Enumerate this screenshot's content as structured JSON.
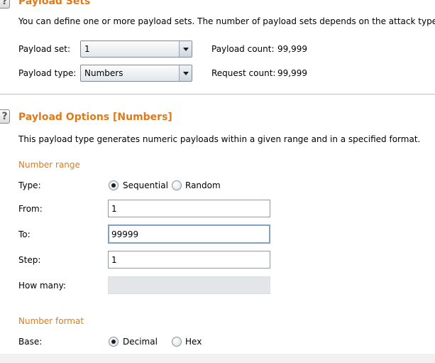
{
  "payload_sets": {
    "title": "Payload Sets",
    "description": "You can define one or more payload sets. The number of payload sets depends on the attack type def",
    "payload_set_label": "Payload set:",
    "payload_set_value": "1",
    "payload_type_label": "Payload type:",
    "payload_type_value": "Numbers",
    "payload_count_label": "Payload count:",
    "payload_count_value": "99,999",
    "request_count_label": "Request count:",
    "request_count_value": "99,999"
  },
  "payload_options": {
    "title": "Payload Options [Numbers]",
    "description": "This payload type generates numeric payloads within a given range and in a specified format.",
    "number_range": {
      "heading": "Number range",
      "type_label": "Type:",
      "type_options": [
        "Sequential",
        "Random"
      ],
      "type_selected": "Sequential",
      "from_label": "From:",
      "from_value": "1",
      "to_label": "To:",
      "to_value": "99999",
      "step_label": "Step:",
      "step_value": "1",
      "how_many_label": "How many:",
      "how_many_value": ""
    },
    "number_format": {
      "heading": "Number format",
      "base_label": "Base:",
      "base_options": [
        "Decimal",
        "Hex"
      ],
      "base_selected": "Decimal"
    }
  }
}
